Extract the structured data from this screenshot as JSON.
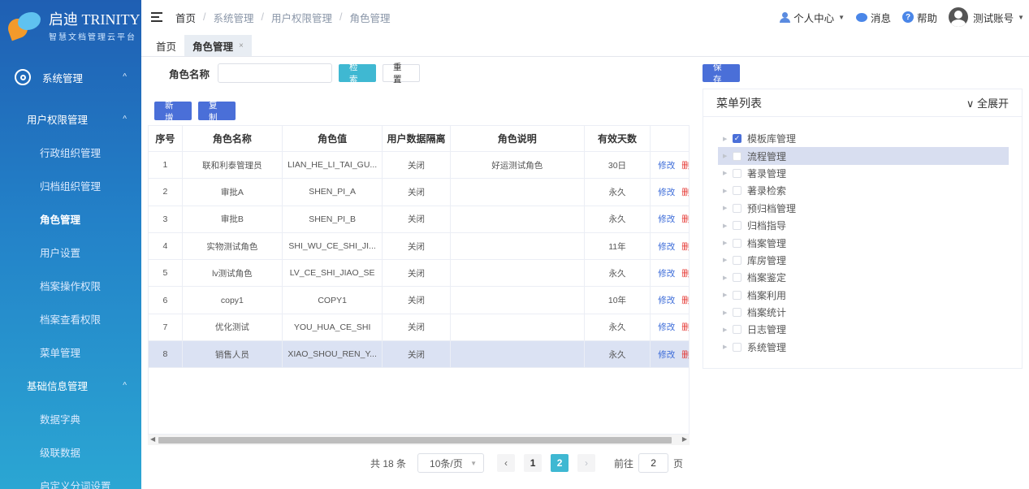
{
  "brand": {
    "name": "启迪 TRINITY",
    "slogan": "智慧文档管理云平台",
    "colors": {
      "sidebar_top": "#1f5fb3",
      "sidebar_bottom": "#2ba6d3",
      "accent": "#3fb8d2",
      "primary": "#4a6fd8"
    }
  },
  "sidebar": {
    "items": [
      {
        "label": "系统管理",
        "level": 0,
        "icon": "gear-icon",
        "caret": "^"
      },
      {
        "label": "用户权限管理",
        "level": 1,
        "caret": "^"
      },
      {
        "label": "行政组织管理",
        "level": 2
      },
      {
        "label": "归档组织管理",
        "level": 2
      },
      {
        "label": "角色管理",
        "level": 2,
        "active": true
      },
      {
        "label": "用户设置",
        "level": 2
      },
      {
        "label": "档案操作权限",
        "level": 2
      },
      {
        "label": "档案查看权限",
        "level": 2
      },
      {
        "label": "菜单管理",
        "level": 2
      },
      {
        "label": "基础信息管理",
        "level": 1,
        "caret": "^"
      },
      {
        "label": "数据字典",
        "level": 2
      },
      {
        "label": "级联数据",
        "level": 2
      },
      {
        "label": "启定义分词设置",
        "level": 2
      }
    ]
  },
  "breadcrumb": [
    "首页",
    "系统管理",
    "用户权限管理",
    "角色管理"
  ],
  "topbar": {
    "personal": "个人中心",
    "messages": "消息",
    "help": "帮助",
    "account": "测试账号",
    "help_glyph": "?"
  },
  "tabs": [
    {
      "label": "首页"
    },
    {
      "label": "角色管理",
      "close": "×"
    }
  ],
  "search": {
    "label": "角色名称",
    "value": "",
    "search_btn": "检索",
    "reset_btn": "重置"
  },
  "toolbar": {
    "add": "新增",
    "copy": "复制"
  },
  "table": {
    "columns": [
      "序号",
      "角色名称",
      "角色值",
      "用户数据隔离",
      "角色说明",
      "有效天数",
      ""
    ],
    "rows": [
      {
        "no": "1",
        "name": "联和利泰管理员",
        "value": "LIAN_HE_LI_TAI_GU...",
        "isolation": "关闭",
        "desc": "好运测试角色",
        "days": "30日"
      },
      {
        "no": "2",
        "name": "审批A",
        "value": "SHEN_PI_A",
        "isolation": "关闭",
        "desc": "",
        "days": "永久"
      },
      {
        "no": "3",
        "name": "审批B",
        "value": "SHEN_PI_B",
        "isolation": "关闭",
        "desc": "",
        "days": "永久"
      },
      {
        "no": "4",
        "name": "实物测试角色",
        "value": "SHI_WU_CE_SHI_JI...",
        "isolation": "关闭",
        "desc": "",
        "days": "11年"
      },
      {
        "no": "5",
        "name": "lv测试角色",
        "value": "LV_CE_SHI_JIAO_SE",
        "isolation": "关闭",
        "desc": "",
        "days": "永久"
      },
      {
        "no": "6",
        "name": "copy1",
        "value": "COPY1",
        "isolation": "关闭",
        "desc": "",
        "days": "10年"
      },
      {
        "no": "7",
        "name": "优化测试",
        "value": "YOU_HUA_CE_SHI",
        "isolation": "关闭",
        "desc": "",
        "days": "永久"
      },
      {
        "no": "8",
        "name": "销售人员",
        "value": "XIAO_SHOU_REN_Y...",
        "isolation": "关闭",
        "desc": "",
        "days": "永久",
        "selected": true
      }
    ],
    "row_actions": {
      "edit": "修改",
      "delete": "删"
    }
  },
  "pagination": {
    "total": "共 18 条",
    "page_size": "10条/页",
    "pages": [
      "1",
      "2"
    ],
    "current": "2",
    "goto_label": "前往",
    "goto_value": "2",
    "goto_suffix": "页",
    "prev": "‹",
    "next": "›"
  },
  "menu_panel": {
    "save": "保存",
    "title": "菜单列表",
    "expand_all": "全展开",
    "items": [
      {
        "label": "模板库管理",
        "checked": true
      },
      {
        "label": "流程管理",
        "highlighted": true
      },
      {
        "label": "著录管理"
      },
      {
        "label": "著录检索"
      },
      {
        "label": "预归档管理"
      },
      {
        "label": "归档指导"
      },
      {
        "label": "档案管理"
      },
      {
        "label": "库房管理"
      },
      {
        "label": "档案鉴定"
      },
      {
        "label": "档案利用"
      },
      {
        "label": "档案统计"
      },
      {
        "label": "日志管理"
      },
      {
        "label": "系统管理"
      }
    ]
  }
}
